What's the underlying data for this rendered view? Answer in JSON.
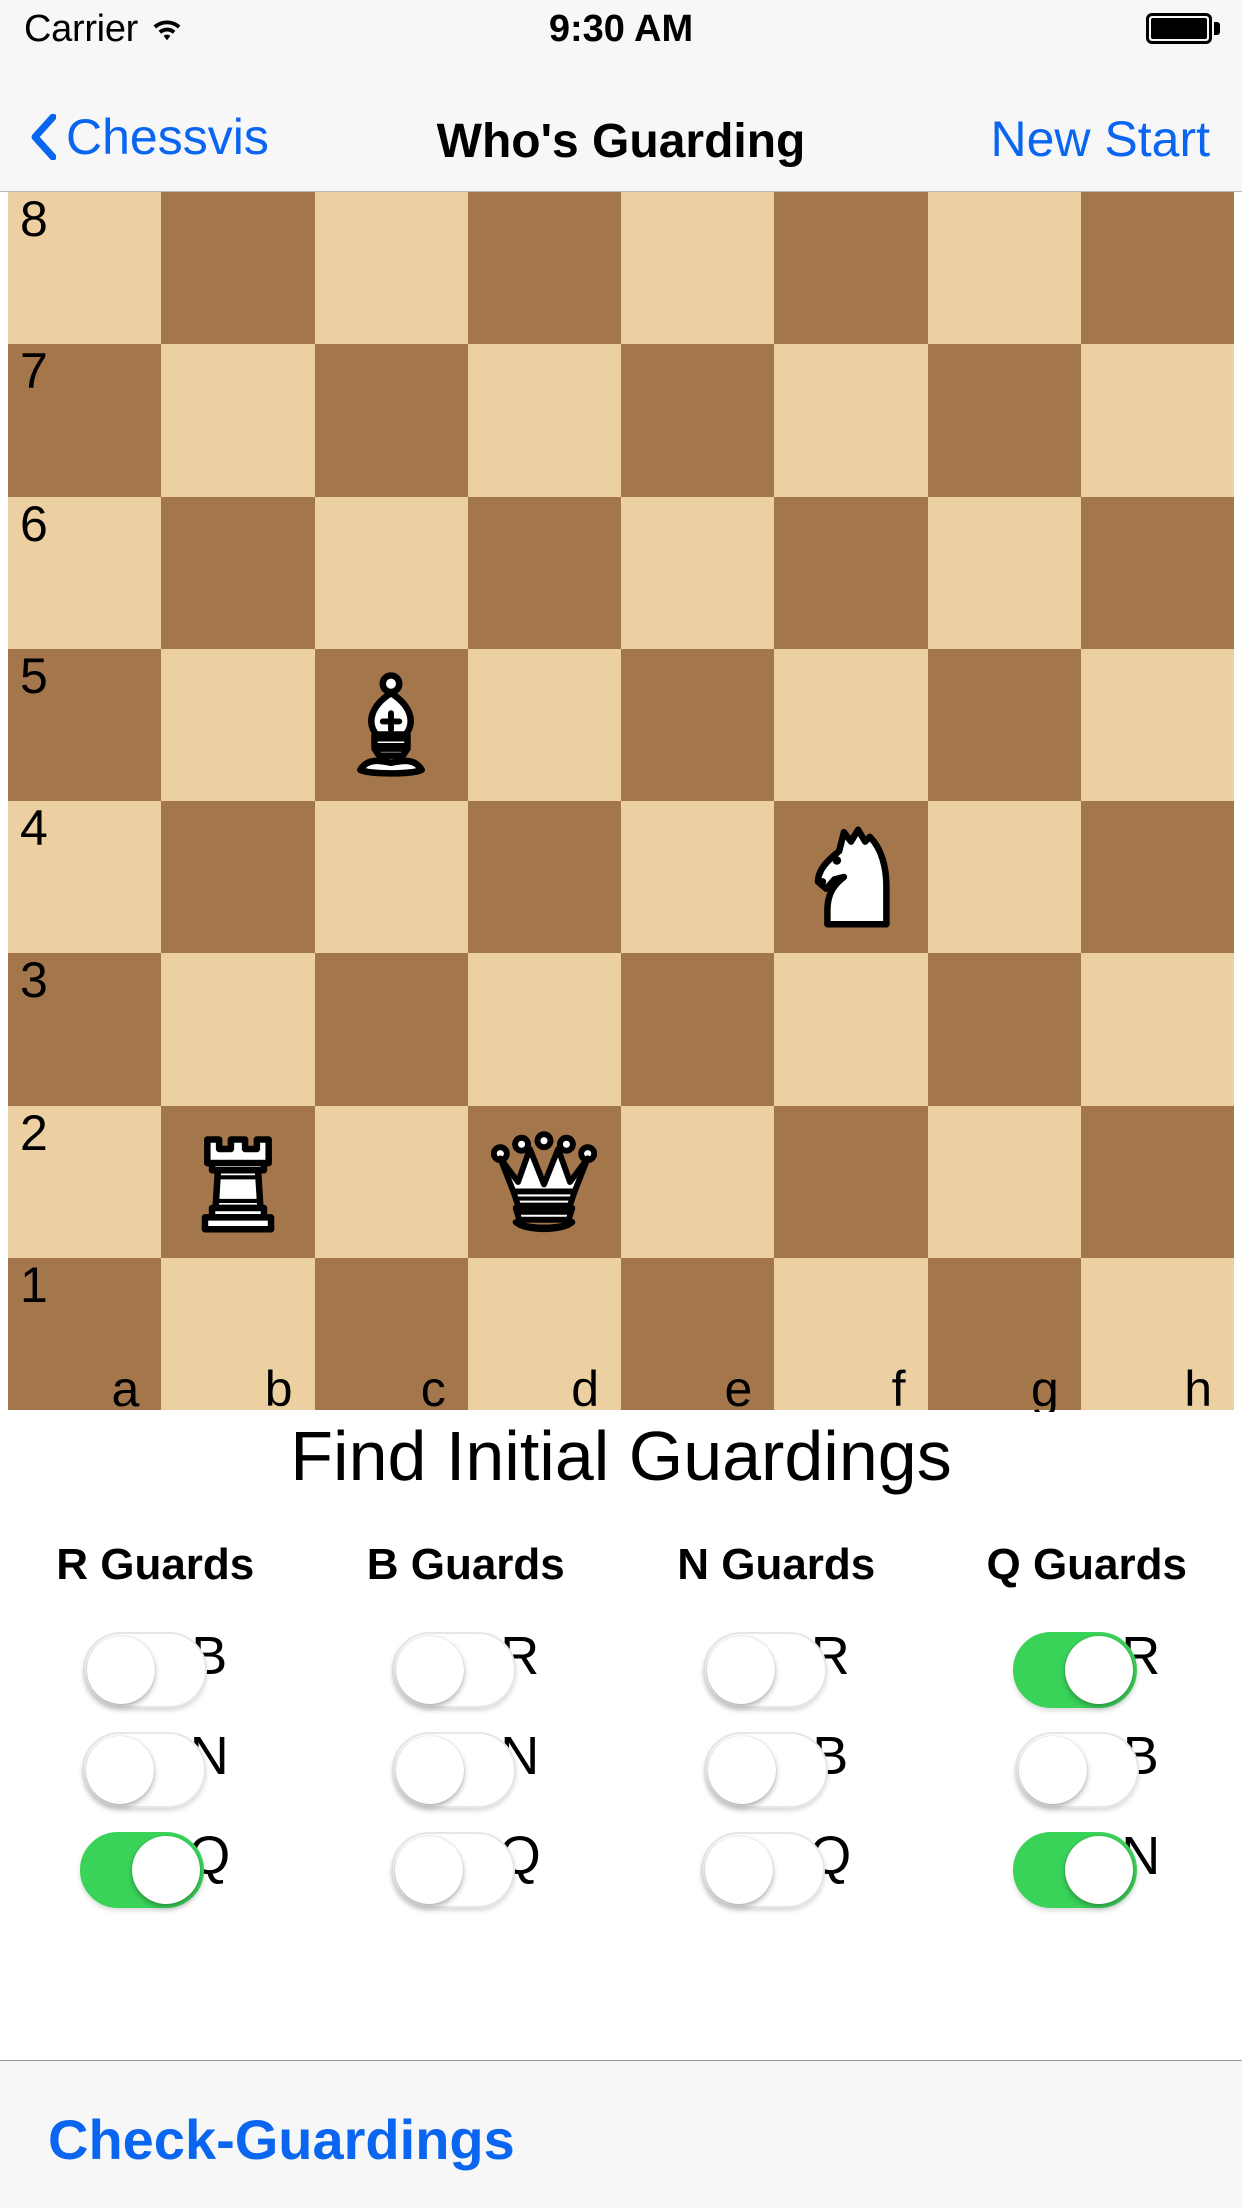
{
  "status_bar": {
    "carrier": "Carrier",
    "wifi_icon": "wifi-icon",
    "time": "9:30 AM",
    "battery_icon": "battery-icon"
  },
  "nav_bar": {
    "back_icon": "chevron-left-icon",
    "back_label": "Chessvis",
    "title": "Who's Guarding",
    "action_label": "New Start"
  },
  "board": {
    "rank_labels": [
      "8",
      "7",
      "6",
      "5",
      "4",
      "3",
      "2",
      "1"
    ],
    "file_labels": [
      "a",
      "b",
      "c",
      "d",
      "e",
      "f",
      "g",
      "h"
    ],
    "light_square_color": "#ecd0a1",
    "dark_square_color": "#a3764b",
    "pieces": [
      {
        "square": "c5",
        "file": 2,
        "rank": 5,
        "type": "bishop",
        "color": "white",
        "icon": "white-bishop-icon"
      },
      {
        "square": "f4",
        "file": 5,
        "rank": 4,
        "type": "knight",
        "color": "white",
        "icon": "white-knight-icon"
      },
      {
        "square": "b2",
        "file": 1,
        "rank": 2,
        "type": "rook",
        "color": "white",
        "icon": "white-rook-icon"
      },
      {
        "square": "d2",
        "file": 3,
        "rank": 2,
        "type": "queen",
        "color": "white",
        "icon": "white-queen-icon"
      }
    ]
  },
  "panel": {
    "title": "Find Initial Guardings",
    "columns": [
      {
        "header": "R Guards"
      },
      {
        "header": "B Guards"
      },
      {
        "header": "N Guards"
      },
      {
        "header": "Q Guards"
      }
    ],
    "toggle_on_color": "#3ad35a",
    "rows": [
      [
        {
          "label": "B",
          "on": false
        },
        {
          "label": "R",
          "on": false
        },
        {
          "label": "R",
          "on": false
        },
        {
          "label": "R",
          "on": true
        }
      ],
      [
        {
          "label": "N",
          "on": false
        },
        {
          "label": "N",
          "on": false
        },
        {
          "label": "B",
          "on": false
        },
        {
          "label": "B",
          "on": false
        }
      ],
      [
        {
          "label": "Q",
          "on": true
        },
        {
          "label": "Q",
          "on": false
        },
        {
          "label": "Q",
          "on": false
        },
        {
          "label": "N",
          "on": true
        }
      ]
    ]
  },
  "footer": {
    "button_label": "Check-Guardings",
    "accent_color": "#0a66f0"
  }
}
